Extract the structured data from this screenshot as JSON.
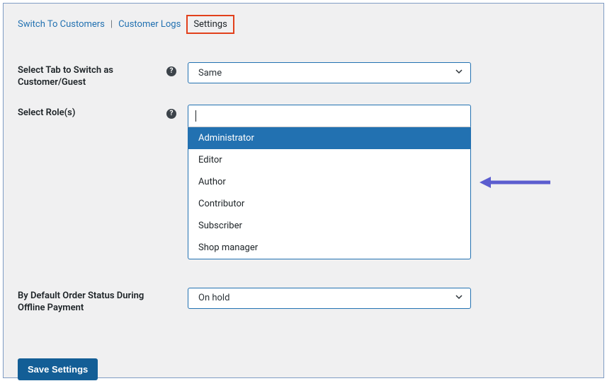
{
  "tabs": {
    "switch": "Switch To Customers",
    "logs": "Customer Logs",
    "settings": "Settings"
  },
  "fields": {
    "tab_switch": {
      "label": "Select Tab to Switch as Customer/Guest",
      "value": "Same"
    },
    "roles": {
      "label": "Select Role(s)",
      "options": [
        "Administrator",
        "Editor",
        "Author",
        "Contributor",
        "Subscriber",
        "Shop manager"
      ]
    },
    "order_status": {
      "label": "By Default Order Status During Offline Payment",
      "value": "On hold"
    }
  },
  "buttons": {
    "save": "Save Settings"
  },
  "colors": {
    "accent": "#2271b1",
    "highlight_red": "#e2401c",
    "arrow": "#5b5dcf"
  }
}
